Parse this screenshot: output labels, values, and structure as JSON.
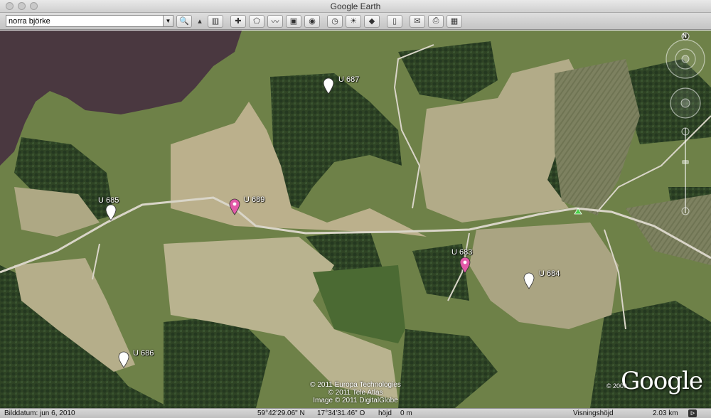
{
  "window": {
    "title": "Google Earth"
  },
  "toolbar": {
    "search_value": "norra björke",
    "buttons": [
      {
        "name": "search-button",
        "glyph": "🔍"
      },
      {
        "name": "collapse-button",
        "glyph": "▴"
      },
      {
        "name": "sidebar-toggle-button",
        "glyph": "▥"
      },
      {
        "name": "add-placemark-button",
        "glyph": "✚"
      },
      {
        "name": "add-polygon-button",
        "glyph": "⬠"
      },
      {
        "name": "add-path-button",
        "glyph": "〰"
      },
      {
        "name": "image-overlay-button",
        "glyph": "▣"
      },
      {
        "name": "record-tour-button",
        "glyph": "◉"
      },
      {
        "name": "historical-imagery-button",
        "glyph": "◷"
      },
      {
        "name": "sunlight-button",
        "glyph": "☀"
      },
      {
        "name": "planet-switch-button",
        "glyph": "◆"
      },
      {
        "name": "ruler-button",
        "glyph": "▯"
      },
      {
        "name": "email-button",
        "glyph": "✉"
      },
      {
        "name": "print-button",
        "glyph": "⎙"
      },
      {
        "name": "view-in-maps-button",
        "glyph": "▦"
      }
    ]
  },
  "placemarks": [
    {
      "label": "U 687",
      "color": "#ffffff"
    },
    {
      "label": "U 685",
      "color": "#ffffff"
    },
    {
      "label": "U 689",
      "color": "#e25aa8"
    },
    {
      "label": "U 683",
      "color": "#e25aa8"
    },
    {
      "label": "U 684",
      "color": "#ffffff"
    },
    {
      "label": "U 686",
      "color": "#ffffff"
    }
  ],
  "attribution": {
    "line1": "© 2011 Europa Technologies",
    "line2": "© 2011 Tele Atlas",
    "line3": "Image © 2011 DigitalGlobe"
  },
  "logo": {
    "text": "Google",
    "year": "© 2009"
  },
  "status": {
    "image_date": "Bilddatum: jun  6, 2010",
    "latitude": "59°42'29.06\" N",
    "longitude": "17°34'31.46\" O",
    "elevation_label": "höjd",
    "elevation_value": "0 m",
    "eye_alt_label": "Visningshöjd",
    "eye_alt_value": "2.03 km"
  },
  "icons": {
    "north": "N",
    "tour_guide": "ᐅ"
  }
}
